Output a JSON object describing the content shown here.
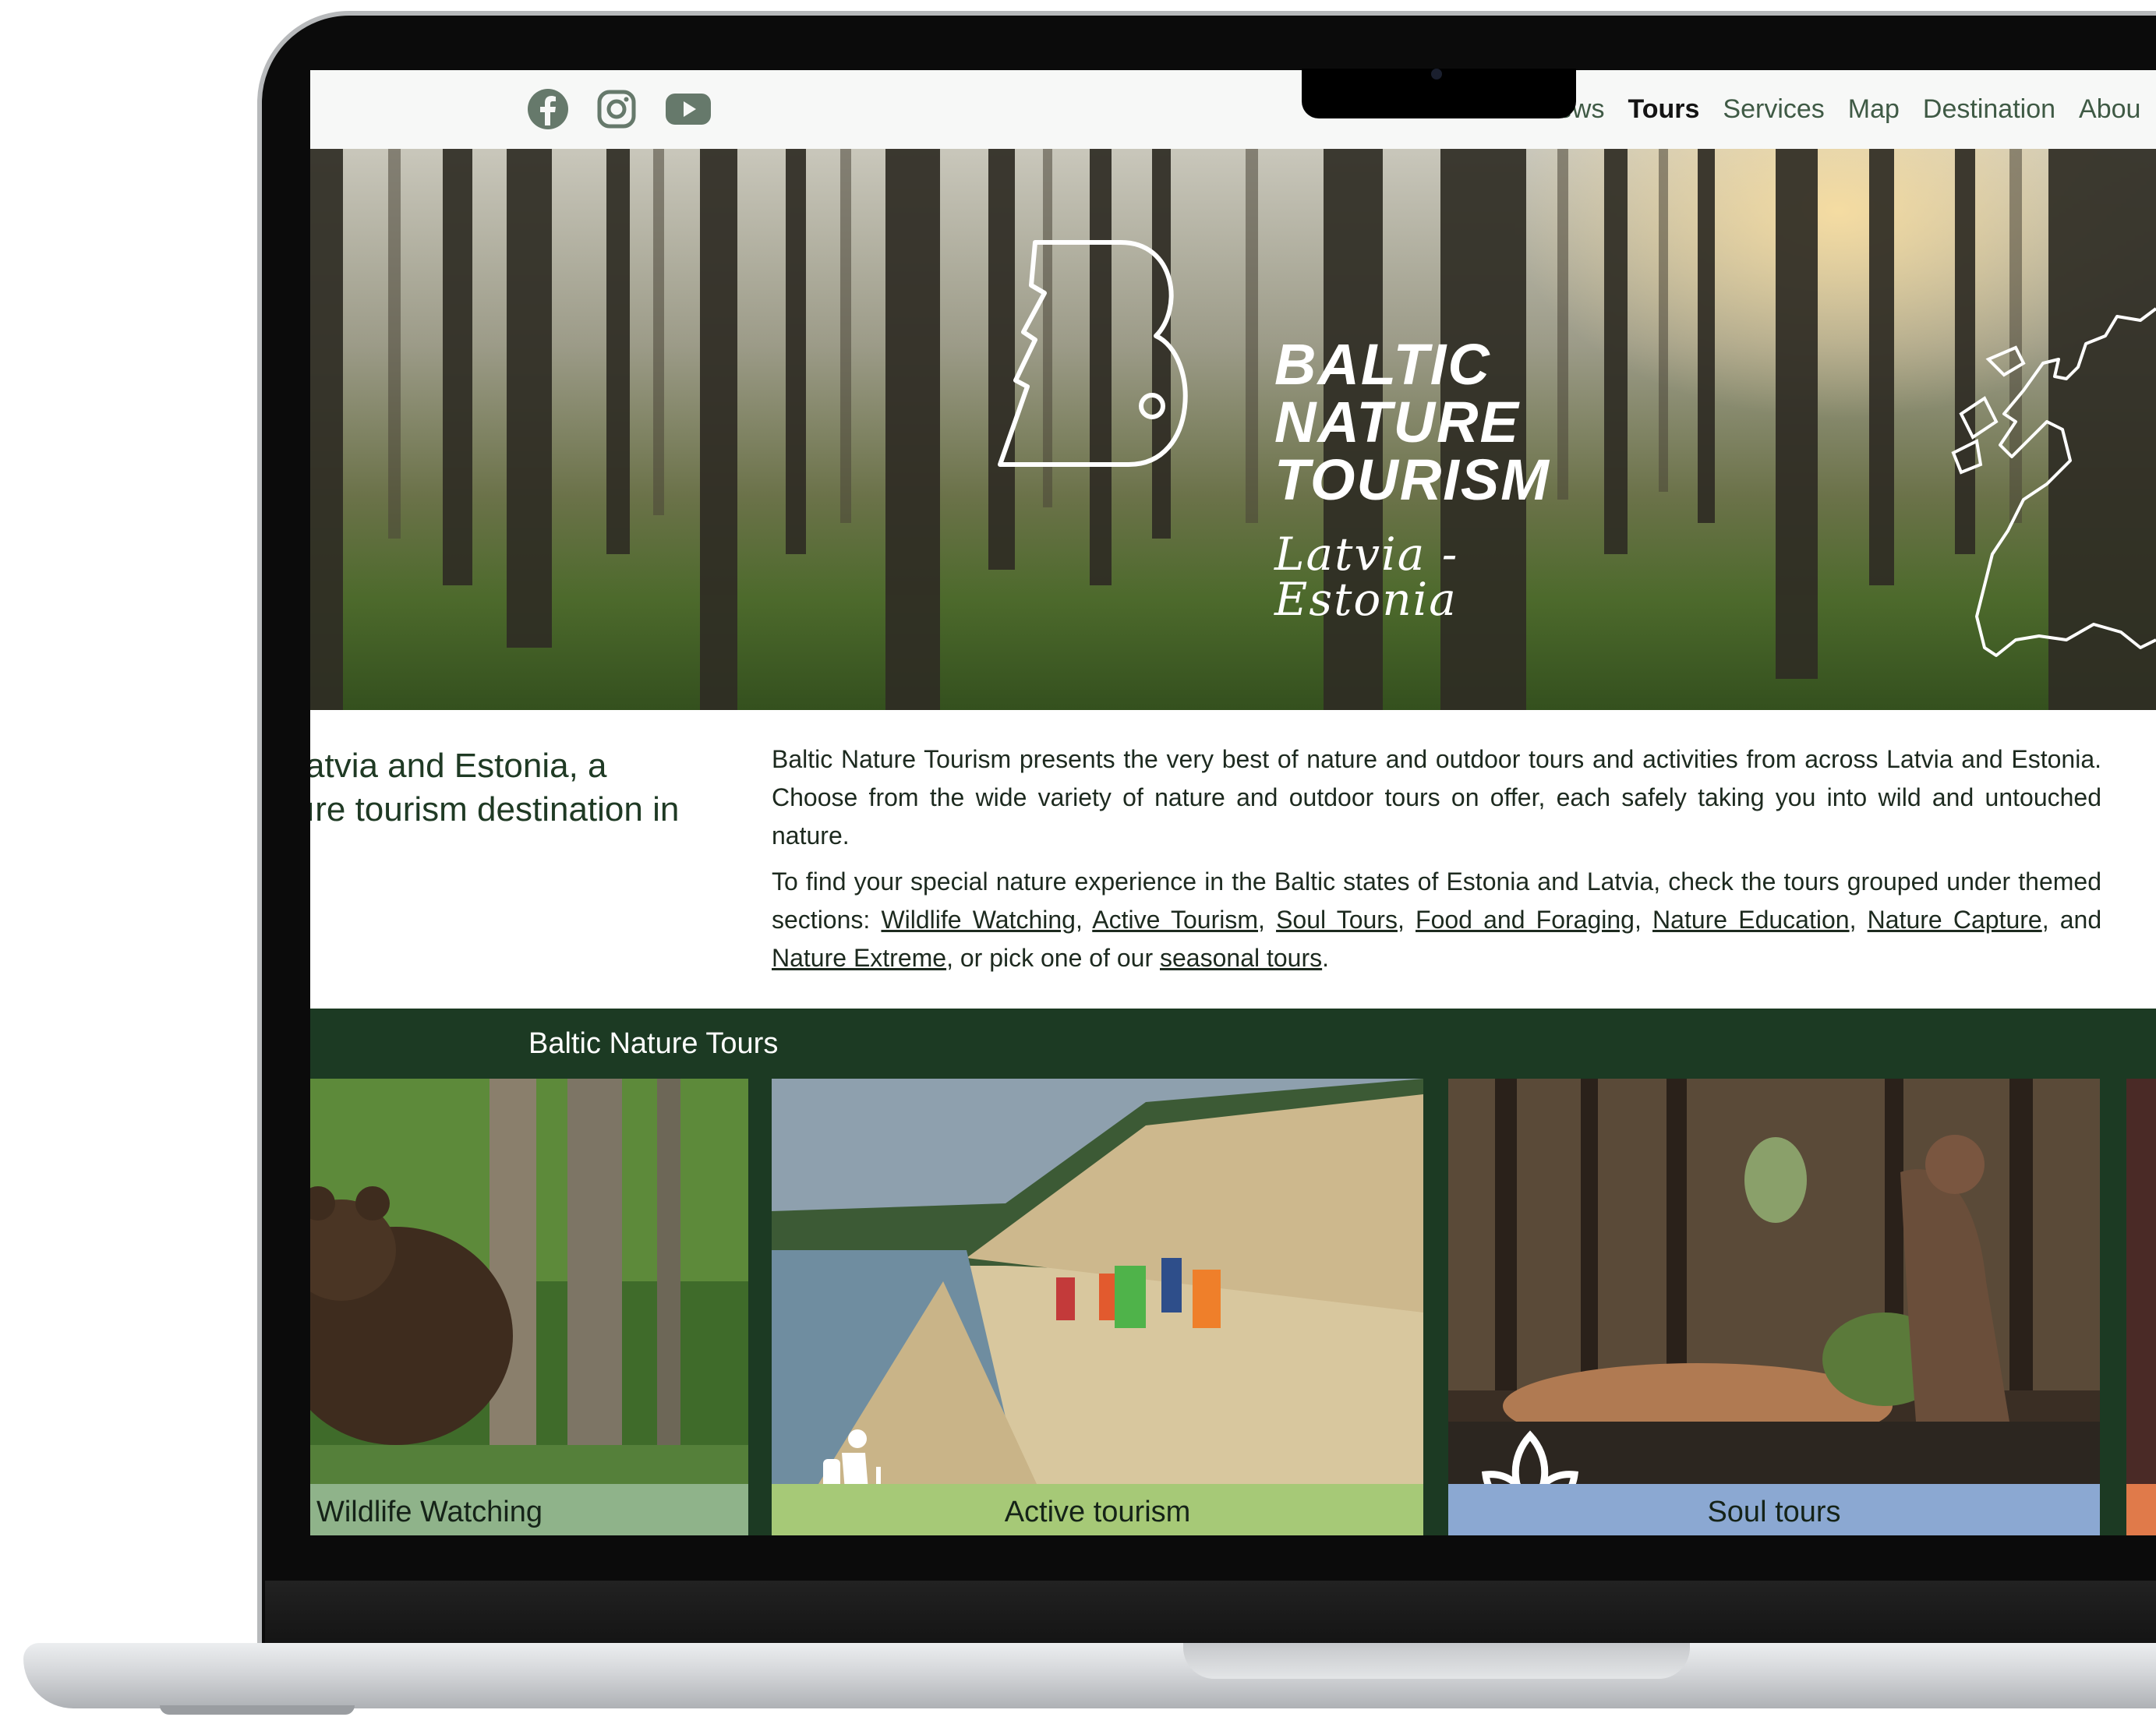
{
  "header": {
    "social": [
      {
        "name": "facebook-icon"
      },
      {
        "name": "instagram-icon"
      },
      {
        "name": "youtube-icon"
      }
    ],
    "nav": [
      "ews",
      "Tours",
      "Services",
      "Map",
      "Destination",
      "Abou"
    ],
    "active_nav": "Tours"
  },
  "hero": {
    "brand_line1": "BALTIC",
    "brand_line2": "NATURE",
    "brand_line3": "TOURISM",
    "subtitle_line1": "Latvia -",
    "subtitle_line2": "Estonia"
  },
  "intro": {
    "heading_line1": "atvia and Estonia, a",
    "heading_line2": "ıre tourism destination in",
    "p1": "Baltic Nature Tourism presents the very best of nature and outdoor tours and activities from across Latvia and Estonia. Choose from the wide variety of nature and outdoor tours on offer, each safely taking you into wild and untouched nature.",
    "p2_before": "To find your special nature experience in the Baltic states of Estonia and Latvia, check the tours grouped under themed sections: ",
    "links": [
      "Wildlife Watching",
      "Active Tourism",
      "Soul Tours",
      "Food and Foraging",
      "Nature Education",
      "Nature Capture",
      "Nature Extreme",
      "seasonal tours"
    ],
    "sep": ", ",
    "and": ", and ",
    "or": ", or pick one of our ",
    "end": "."
  },
  "tours": {
    "title": "Baltic Nature Tours",
    "cards": [
      {
        "label": "Wildlife Watching",
        "color": "#8fb38a"
      },
      {
        "label": "Active tourism",
        "color": "#a6c977"
      },
      {
        "label": "Soul tours",
        "color": "#8ba8d2"
      }
    ]
  },
  "colors": {
    "dark_green": "#1c3a23",
    "nav_text": "#3f5a45",
    "icon_grey": "#66796b"
  }
}
